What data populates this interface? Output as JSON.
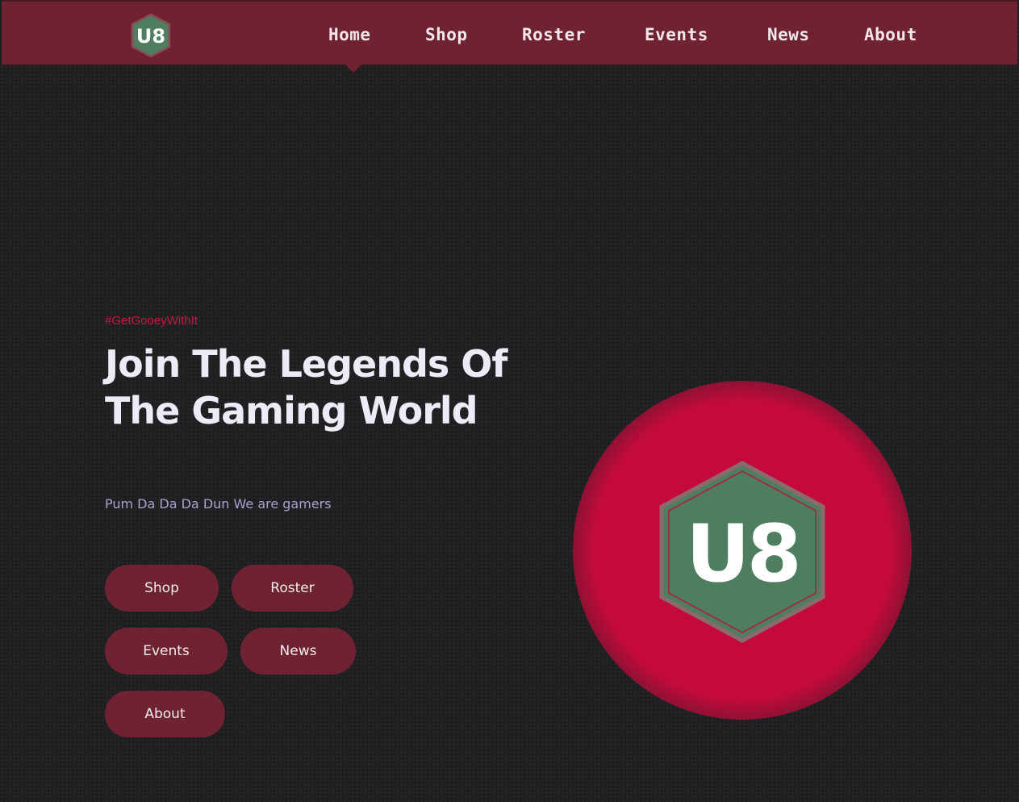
{
  "brand": {
    "logo_text": "U8",
    "logo_fill": "#4f7d5f",
    "logo_outline": "#7a3a48"
  },
  "nav": {
    "active": "Home",
    "items": [
      {
        "label": "Home"
      },
      {
        "label": "Shop"
      },
      {
        "label": "Roster"
      },
      {
        "label": "Events"
      },
      {
        "label": "News"
      },
      {
        "label": "About"
      }
    ]
  },
  "hero": {
    "tag": "#GetGooeyWithIt",
    "title": "Join The Legends Of The Gaming World",
    "subtitle": "Pum Da Da Da Dun We are gamers",
    "buttons": [
      {
        "label": "Shop"
      },
      {
        "label": "Roster"
      },
      {
        "label": "Events"
      },
      {
        "label": "News"
      },
      {
        "label": "About"
      }
    ]
  },
  "colors": {
    "background": "#1f1f22",
    "navbar": "#6e2232",
    "accent": "#c8173f",
    "glow": "#c40a3c",
    "title": "#ecebf6",
    "subtitle": "#a7a4cc"
  },
  "icons": {
    "nav_logo": "u8-logo-icon",
    "hero_logo": "u8-logo-icon"
  }
}
